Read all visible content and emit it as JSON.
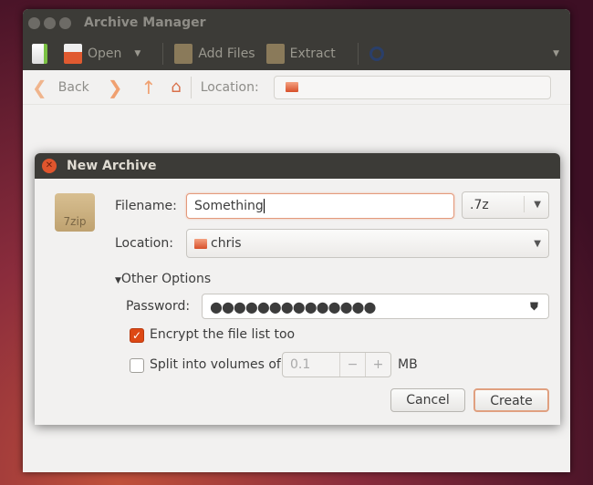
{
  "window": {
    "title": "Archive Manager"
  },
  "toolbar": {
    "open": "Open",
    "add_files": "Add Files",
    "extract": "Extract"
  },
  "navbar": {
    "back": "Back",
    "location_label": "Location:"
  },
  "dialog": {
    "title": "New Archive",
    "archive_icon_label": "7zip",
    "filename_label": "Filename:",
    "filename_value": "Something",
    "format_value": ".7z",
    "location_label": "Location:",
    "location_value": "chris",
    "other_options": "Other Options",
    "password_label": "Password:",
    "password_value": "●●●●●●●●●●●●●●",
    "encrypt_label": "Encrypt the file list too",
    "encrypt_checked": true,
    "split_label": "Split into volumes of",
    "split_checked": false,
    "split_value": "0.1",
    "split_unit": "MB",
    "cancel": "Cancel",
    "create": "Create"
  },
  "colors": {
    "accent": "#dd4814",
    "titlebar": "#3c3b37"
  }
}
